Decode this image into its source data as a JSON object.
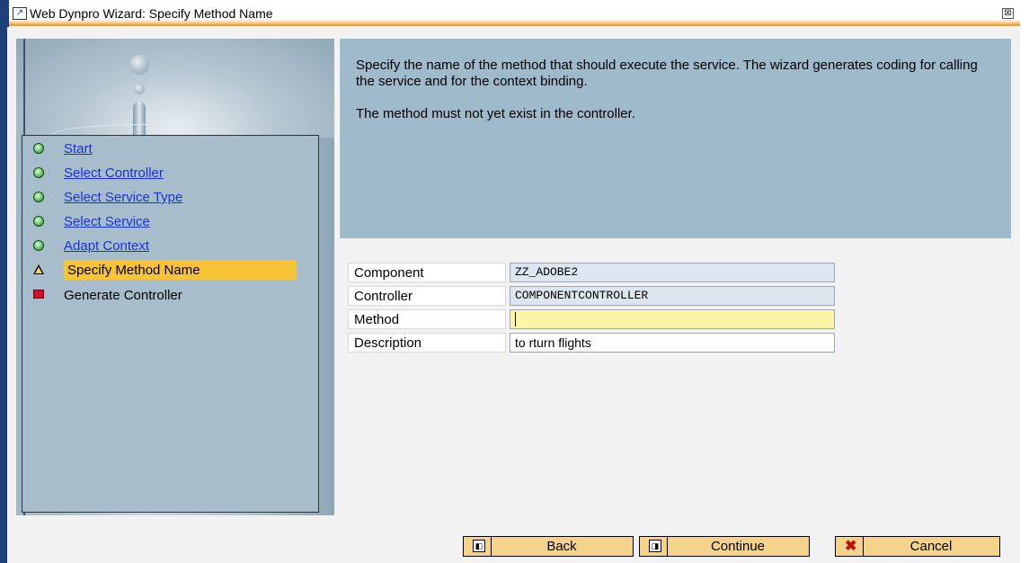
{
  "window": {
    "title": "Web Dynpro Wizard: Specify Method Name",
    "close_glyph": "⊠",
    "title_icon": "window-icon"
  },
  "steps": [
    {
      "label": "Start",
      "status": "done",
      "icon": "green-dot-icon",
      "link": true
    },
    {
      "label": "Select Controller",
      "status": "done",
      "icon": "green-dot-icon",
      "link": true
    },
    {
      "label": "Select Service Type",
      "status": "done",
      "icon": "green-dot-icon",
      "link": true
    },
    {
      "label": "Select Service",
      "status": "done",
      "icon": "green-dot-icon",
      "link": true
    },
    {
      "label": "Adapt Context",
      "status": "done",
      "icon": "green-dot-icon",
      "link": true
    },
    {
      "label": "Specify Method Name",
      "status": "current",
      "icon": "warning-icon",
      "link": false
    },
    {
      "label": "Generate Controller",
      "status": "pending",
      "icon": "red-square-icon",
      "link": false
    }
  ],
  "info": {
    "paragraph1": "Specify the name of the method that should execute the service. The wizard generates coding for calling the service and for the context binding.",
    "paragraph2": "The method must not yet exist in the controller."
  },
  "form": {
    "component": {
      "label": "Component",
      "value": "ZZ_ADOBE2"
    },
    "controller": {
      "label": "Controller",
      "value": "COMPONENTCONTROLLER"
    },
    "method": {
      "label": "Method",
      "value": ""
    },
    "description": {
      "label": "Description",
      "value": "to rturn flights"
    }
  },
  "buttons": {
    "back": "Back",
    "continue": "Continue",
    "cancel": "Cancel"
  },
  "colors": {
    "panel": "#9fbacb",
    "current_step": "#f7c436",
    "button": "#f4d48a",
    "link": "#1a33d0"
  }
}
